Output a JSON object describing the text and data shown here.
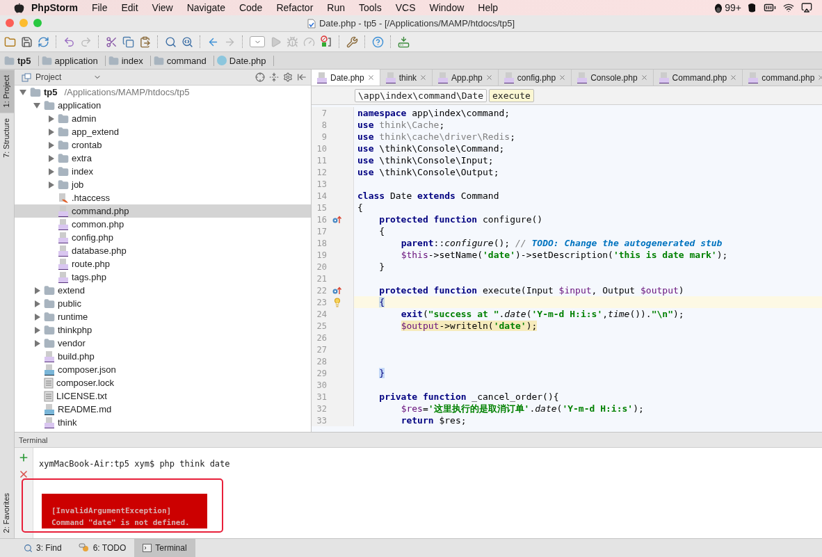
{
  "menubar": {
    "app": "PhpStorm",
    "menus": [
      "File",
      "Edit",
      "View",
      "Navigate",
      "Code",
      "Refactor",
      "Run",
      "Tools",
      "VCS",
      "Window",
      "Help"
    ],
    "badge": "99+"
  },
  "window": {
    "title": "Date.php - tp5 - [/Applications/MAMP/htdocs/tp5]"
  },
  "breadcrumbs": [
    {
      "label": "tp5",
      "kind": "root"
    },
    {
      "label": "application",
      "kind": "folder"
    },
    {
      "label": "index",
      "kind": "folder"
    },
    {
      "label": "command",
      "kind": "folder"
    },
    {
      "label": "Date.php",
      "kind": "class"
    }
  ],
  "tool_strip": {
    "top": [
      {
        "label": "1: Project",
        "selected": true
      },
      {
        "label": "7: Structure",
        "selected": false
      }
    ],
    "bottom": [
      {
        "label": "2: Favorites",
        "selected": false
      }
    ]
  },
  "project": {
    "title": "Project",
    "tree": [
      {
        "name": "tp5",
        "path": "/Applications/MAMP/htdocs/tp5",
        "kind": "root",
        "expanded": true,
        "selected": false,
        "children": [
          {
            "name": "application",
            "kind": "folder",
            "expanded": true,
            "selected": false,
            "children": [
              {
                "name": "admin",
                "kind": "folder",
                "expanded": false,
                "selected": false
              },
              {
                "name": "app_extend",
                "kind": "folder",
                "expanded": false,
                "selected": false
              },
              {
                "name": "crontab",
                "kind": "folder",
                "expanded": false,
                "selected": false
              },
              {
                "name": "extra",
                "kind": "folder",
                "expanded": false,
                "selected": false
              },
              {
                "name": "index",
                "kind": "folder",
                "expanded": false,
                "selected": false
              },
              {
                "name": "job",
                "kind": "folder",
                "expanded": false,
                "selected": false
              },
              {
                "name": ".htaccess",
                "kind": "htaccess",
                "selected": false
              },
              {
                "name": "command.php",
                "kind": "php",
                "selected": true
              },
              {
                "name": "common.php",
                "kind": "php",
                "selected": false
              },
              {
                "name": "config.php",
                "kind": "php",
                "selected": false
              },
              {
                "name": "database.php",
                "kind": "php",
                "selected": false
              },
              {
                "name": "route.php",
                "kind": "php",
                "selected": false
              },
              {
                "name": "tags.php",
                "kind": "php",
                "selected": false
              }
            ]
          },
          {
            "name": "extend",
            "kind": "folder",
            "expanded": false,
            "selected": false
          },
          {
            "name": "public",
            "kind": "folder",
            "expanded": false,
            "selected": false
          },
          {
            "name": "runtime",
            "kind": "folder",
            "expanded": false,
            "selected": false
          },
          {
            "name": "thinkphp",
            "kind": "folder",
            "expanded": false,
            "selected": false
          },
          {
            "name": "vendor",
            "kind": "folder",
            "expanded": false,
            "selected": false
          },
          {
            "name": "build.php",
            "kind": "php",
            "selected": false
          },
          {
            "name": "composer.json",
            "kind": "json",
            "selected": false
          },
          {
            "name": "composer.lock",
            "kind": "text",
            "selected": false
          },
          {
            "name": "LICENSE.txt",
            "kind": "text",
            "selected": false
          },
          {
            "name": "README.md",
            "kind": "md",
            "selected": false
          },
          {
            "name": "think",
            "kind": "php",
            "selected": false
          }
        ]
      }
    ]
  },
  "editor": {
    "tabs": [
      {
        "label": "Date.php",
        "selected": true
      },
      {
        "label": "think",
        "selected": false
      },
      {
        "label": "App.php",
        "selected": false
      },
      {
        "label": "config.php",
        "selected": false
      },
      {
        "label": "Console.php",
        "selected": false
      },
      {
        "label": "Command.php",
        "selected": false
      },
      {
        "label": "command.php",
        "selected": false
      }
    ],
    "path": [
      {
        "label": "\\app\\index\\command\\Date",
        "selected": false
      },
      {
        "label": "execute",
        "selected": true
      }
    ],
    "lines": [
      {
        "number": "7",
        "current": false,
        "warning": false,
        "tokens": [
          {
            "text": "namespace",
            "kind": "kw"
          },
          {
            "text": " app\\index\\command;",
            "kind": "plain"
          }
        ]
      },
      {
        "number": "8",
        "current": false,
        "warning": false,
        "tokens": [
          {
            "text": "use",
            "kind": "kw"
          },
          {
            "text": " think\\Cache",
            "kind": "dim"
          },
          {
            "text": ";",
            "kind": "plain"
          }
        ]
      },
      {
        "number": "9",
        "current": false,
        "warning": false,
        "tokens": [
          {
            "text": "use",
            "kind": "kw"
          },
          {
            "text": " think\\cache\\driver\\Redis",
            "kind": "dim"
          },
          {
            "text": ";",
            "kind": "plain"
          }
        ]
      },
      {
        "number": "10",
        "current": false,
        "warning": false,
        "tokens": [
          {
            "text": "use",
            "kind": "kw"
          },
          {
            "text": " \\think\\Console\\Command;",
            "kind": "plain"
          }
        ]
      },
      {
        "number": "11",
        "current": false,
        "warning": false,
        "tokens": [
          {
            "text": "use",
            "kind": "kw"
          },
          {
            "text": " \\think\\Console\\Input;",
            "kind": "plain"
          }
        ]
      },
      {
        "number": "12",
        "current": false,
        "warning": false,
        "tokens": [
          {
            "text": "use",
            "kind": "kw"
          },
          {
            "text": " \\think\\Console\\Output;",
            "kind": "plain"
          }
        ]
      },
      {
        "number": "13",
        "current": false
      },
      {
        "number": "14",
        "current": false,
        "warning": false,
        "tokens": [
          {
            "text": "class",
            "kind": "kw"
          },
          {
            "text": " Date ",
            "kind": "plain"
          },
          {
            "text": "extends",
            "kind": "kw"
          },
          {
            "text": " Command",
            "kind": "plain"
          }
        ]
      },
      {
        "number": "15",
        "current": false,
        "warning": false,
        "tokens": [
          {
            "text": "{",
            "kind": "plain"
          }
        ]
      },
      {
        "number": "16",
        "kind": "override",
        "current": false,
        "warning": false,
        "tokens": [
          {
            "text": "    protected function",
            "kind": "kw"
          },
          {
            "text": " configure()",
            "kind": "plain"
          }
        ]
      },
      {
        "number": "17",
        "current": false,
        "warning": false,
        "tokens": [
          {
            "text": "    {",
            "kind": "plain"
          }
        ]
      },
      {
        "number": "18",
        "current": false,
        "warning": false,
        "tokens": [
          {
            "text": "        parent",
            "kind": "kw"
          },
          {
            "text": "::",
            "kind": "plain"
          },
          {
            "text": "configure",
            "kind": "call"
          },
          {
            "text": "(); ",
            "kind": "plain"
          },
          {
            "text": "// ",
            "kind": "comment"
          },
          {
            "text": "TODO: Change the autogenerated stub",
            "kind": "todo"
          }
        ]
      },
      {
        "number": "19",
        "current": false,
        "warning": false,
        "tokens": [
          {
            "text": "        $this",
            "kind": "var"
          },
          {
            "text": "->setName(",
            "kind": "plain"
          },
          {
            "text": "'date'",
            "kind": "str"
          },
          {
            "text": ")->setDescription(",
            "kind": "plain"
          },
          {
            "text": "'this is date mark'",
            "kind": "str"
          },
          {
            "text": ");",
            "kind": "plain"
          }
        ]
      },
      {
        "number": "20",
        "current": false,
        "warning": false,
        "tokens": [
          {
            "text": "    }",
            "kind": "plain"
          }
        ]
      },
      {
        "number": "21",
        "current": false
      },
      {
        "number": "22",
        "kind": "override",
        "current": false,
        "warning": false,
        "tokens": [
          {
            "text": "    protected function",
            "kind": "kw"
          },
          {
            "text": " execute(Input ",
            "kind": "plain"
          },
          {
            "text": "$input",
            "kind": "var"
          },
          {
            "text": ", Output ",
            "kind": "plain"
          },
          {
            "text": "$output",
            "kind": "var"
          },
          {
            "text": ")",
            "kind": "plain"
          }
        ]
      },
      {
        "number": "23",
        "kind": "bulb",
        "current": true,
        "warning": false,
        "tokens": [
          {
            "text": "    {",
            "kind": "match"
          }
        ]
      },
      {
        "number": "24",
        "current": false,
        "warning": false,
        "tokens": [
          {
            "text": "        exit",
            "kind": "kw"
          },
          {
            "text": "(",
            "kind": "plain"
          },
          {
            "text": "\"success at \"",
            "kind": "str"
          },
          {
            "text": ".",
            "kind": "plain"
          },
          {
            "text": "date",
            "kind": "call"
          },
          {
            "text": "(",
            "kind": "plain"
          },
          {
            "text": "'Y-m-d H:i:s'",
            "kind": "str"
          },
          {
            "text": ",",
            "kind": "plain"
          },
          {
            "text": "time",
            "kind": "call"
          },
          {
            "text": "()).",
            "kind": "plain"
          },
          {
            "text": "\"\\n\"",
            "kind": "str"
          },
          {
            "text": ");",
            "kind": "plain"
          }
        ]
      },
      {
        "number": "25",
        "current": false,
        "warning": true,
        "tokens": [
          {
            "text": "        $output",
            "kind": "var"
          },
          {
            "text": "->writeln(",
            "kind": "plain"
          },
          {
            "text": "'date'",
            "kind": "str"
          },
          {
            "text": ");",
            "kind": "plain"
          }
        ]
      },
      {
        "number": "26",
        "current": false
      },
      {
        "number": "27",
        "current": false
      },
      {
        "number": "28",
        "current": false
      },
      {
        "number": "29",
        "current": false,
        "warning": false,
        "tokens": [
          {
            "text": "    }",
            "kind": "match"
          }
        ]
      },
      {
        "number": "30",
        "current": false
      },
      {
        "number": "31",
        "current": false,
        "warning": false,
        "tokens": [
          {
            "text": "    private function",
            "kind": "kw"
          },
          {
            "text": " _cancel_order(){",
            "kind": "plain"
          }
        ]
      },
      {
        "number": "32",
        "current": false,
        "warning": false,
        "tokens": [
          {
            "text": "        $res",
            "kind": "var"
          },
          {
            "text": "=",
            "kind": "plain"
          },
          {
            "text": "'这里执行的是取消订单'",
            "kind": "str"
          },
          {
            "text": ".",
            "kind": "plain"
          },
          {
            "text": "date",
            "kind": "call"
          },
          {
            "text": "(",
            "kind": "plain"
          },
          {
            "text": "'Y-m-d H:i:s'",
            "kind": "str"
          },
          {
            "text": ");",
            "kind": "plain"
          }
        ]
      },
      {
        "number": "33",
        "current": false,
        "warning": false,
        "tokens": [
          {
            "text": "        return",
            "kind": "kw"
          },
          {
            "text": " $res;",
            "kind": "plain"
          }
        ]
      }
    ]
  },
  "terminal": {
    "title": "Terminal",
    "prompt": "xymMacBook-Air:tp5 xym$ php think date",
    "error": [
      "[InvalidArgumentException]",
      "Command \"date\" is not defined."
    ]
  },
  "bottom_tabs": [
    {
      "label": "3: Find",
      "kind": "find",
      "selected": false
    },
    {
      "label": "6: TODO",
      "kind": "todo",
      "selected": false
    },
    {
      "label": "Terminal",
      "kind": "terminal",
      "selected": true
    }
  ]
}
